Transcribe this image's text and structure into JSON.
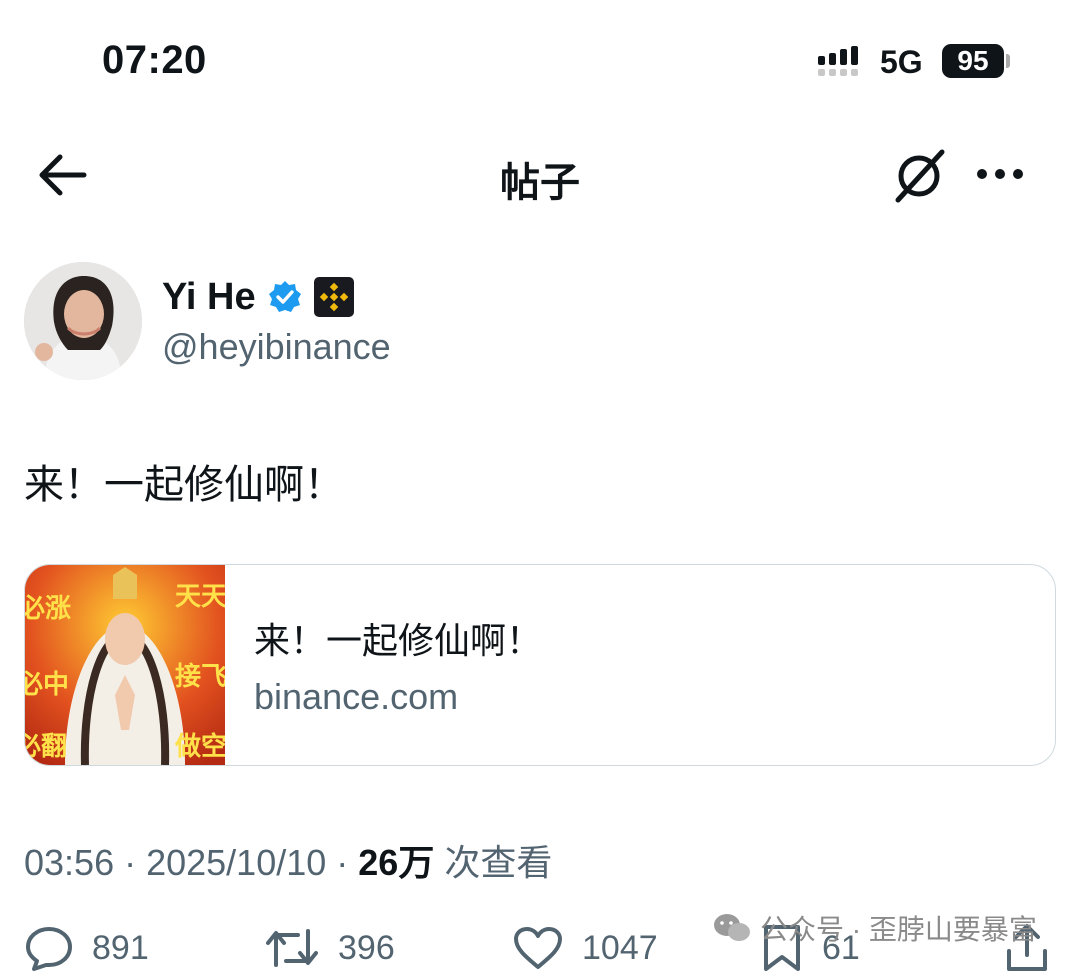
{
  "status_bar": {
    "time": "07:20",
    "network": "5G",
    "battery": "95"
  },
  "header": {
    "title": "帖子",
    "back_icon": "arrow-left-icon",
    "grok_icon": "grok-icon",
    "more_icon": "more-horizontal-icon"
  },
  "author": {
    "name": "Yi He",
    "handle": "@heyibinance",
    "verified": true,
    "affiliation_icon": "binance-logo-icon"
  },
  "tweet": {
    "text": "来！一起修仙啊！"
  },
  "link_card": {
    "title": "来！一起修仙啊！",
    "domain": "binance.com",
    "thumbnail_texts": [
      "必涨",
      "天天",
      "必中",
      "接飞",
      "必翻",
      "做空"
    ]
  },
  "meta": {
    "time": "03:56",
    "date": "2025/10/10",
    "views": "26万",
    "views_label": "次查看",
    "sep": " · "
  },
  "actions": {
    "replies": "891",
    "reposts": "396",
    "likes": "1047",
    "bookmarks": "61"
  },
  "watermark": {
    "text": "公众号 · 歪脖山要暴富"
  },
  "colors": {
    "text": "#0f1419",
    "secondary": "#536471",
    "verified": "#1d9bf0",
    "card_border": "#cfd9de",
    "binance_yellow": "#f0b90b"
  }
}
